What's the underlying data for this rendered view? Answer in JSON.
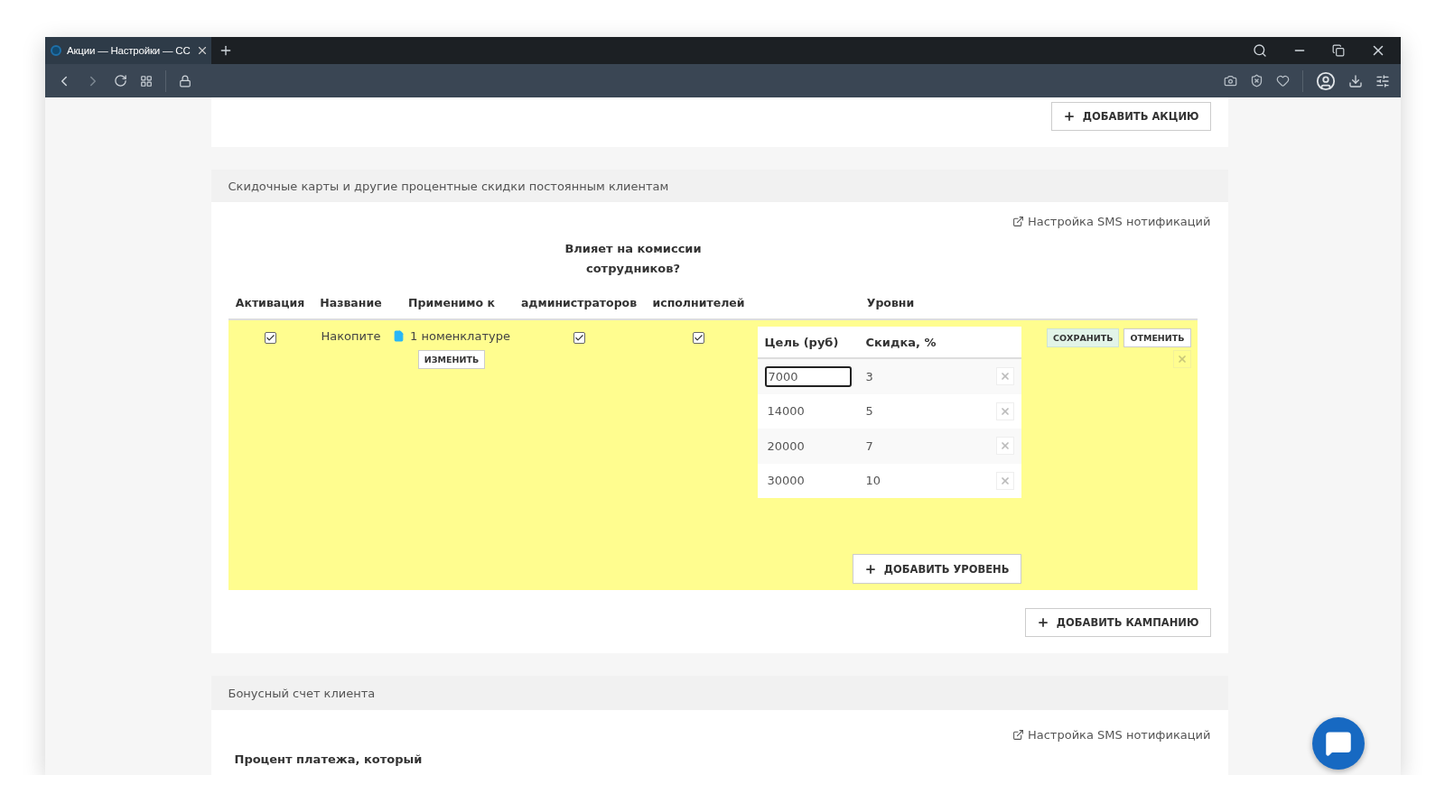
{
  "browser": {
    "tab_title": "Акции — Настройки — СС"
  },
  "promotions": {
    "add_button": "ДОБАВИТЬ АКЦИЮ"
  },
  "discount_cards": {
    "header": "Скидочные карты и другие процентные скидки постоянным клиентам",
    "sms_link": "Настройка SMS нотификаций",
    "commission_group": "Влияет на комиссии сотрудников?",
    "columns": [
      "Активация",
      "Название",
      "Применимо к",
      "администраторов",
      "исполнителей",
      "Уровни"
    ],
    "rows": [
      {
        "highlighted": true,
        "active": true,
        "name": "Накопите",
        "applies_to": "1 номенклатуре",
        "change_button": "ИЗМЕНИТЬ",
        "admins": true,
        "performers": true,
        "levels": {
          "columns": [
            "Цель (руб)",
            "Скидка, %"
          ],
          "rows": [
            {
              "kind": "input",
              "goal": "7000",
              "discount": "3"
            },
            {
              "kind": "text",
              "goal": "14000",
              "discount": "5"
            },
            {
              "kind": "text",
              "goal": "20000",
              "discount": "7"
            },
            {
              "kind": "text",
              "goal": "30000",
              "discount": "10"
            }
          ]
        },
        "add_level_button": "ДОБАВИТЬ УРОВЕНЬ",
        "save_button": "СОХРАНИТЬ",
        "cancel_button": "ОТМЕНИТЬ"
      }
    ],
    "add_button": "ДОБАВИТЬ КАМПАНИЮ"
  },
  "bonus_account": {
    "header": "Бонусный счет клиента",
    "sms_link": "Настройка SMS нотификаций",
    "label": "Процент платежа, который"
  }
}
